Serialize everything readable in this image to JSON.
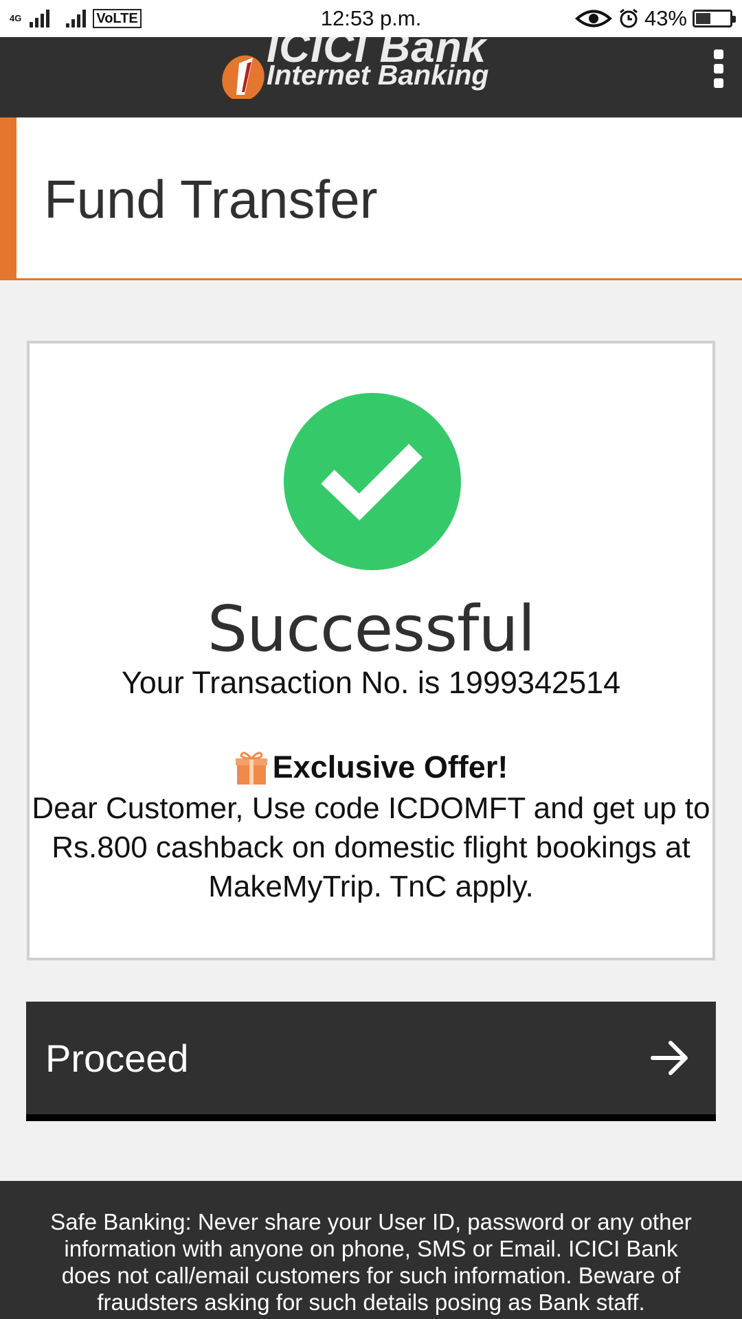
{
  "status_bar": {
    "network_type": "4G",
    "volte_label": "VoLTE",
    "time": "12:53 p.m.",
    "battery_percent": "43%",
    "battery_level": 0.43
  },
  "header": {
    "logo_brand": "ICICI Bank",
    "logo_subtitle": "Internet Banking",
    "menu_icon": "kebab-menu-icon"
  },
  "page": {
    "title": "Fund Transfer"
  },
  "result": {
    "icon": "check-circle-icon",
    "status": "Successful",
    "transaction_text": "Your Transaction No. is 1999342514"
  },
  "offer": {
    "icon": "gift-icon",
    "title": "Exclusive Offer!",
    "body": "Dear Customer, Use code ICDOMFT and get up to Rs.800 cashback on domestic flight bookings at MakeMyTrip. TnC apply."
  },
  "actions": {
    "proceed_label": "Proceed",
    "proceed_icon": "arrow-right-icon"
  },
  "footer": {
    "safe_banking_text": "Safe Banking: Never share your User ID, password or any other information with anyone on phone, SMS or Email. ICICI Bank does not call/email customers for such information. Beware of fraudsters asking for such details posing as Bank staff."
  },
  "colors": {
    "accent_orange": "#e4762d",
    "dark_header": "#303030",
    "success_green": "#36c96a",
    "background": "#f1f1f1"
  }
}
